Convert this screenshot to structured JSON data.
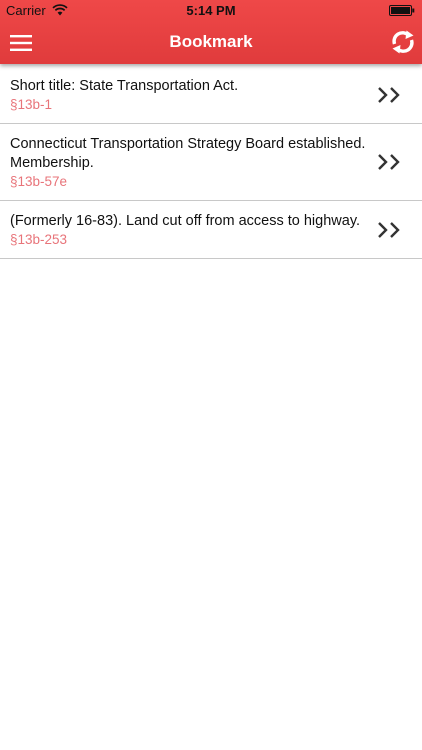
{
  "status_bar": {
    "carrier": "Carrier",
    "time": "5:14 PM"
  },
  "header": {
    "title": "Bookmark",
    "menu_icon": "hamburger-menu-icon",
    "refresh_icon": "refresh-icon",
    "background_color": "#e84444"
  },
  "bookmarks": [
    {
      "title": "Short title: State Transportation Act.",
      "section": "§13b-1"
    },
    {
      "title": "Connecticut Transportation Strategy Board established. Membership.",
      "section": "§13b-57e"
    },
    {
      "title": "(Formerly 16-83). Land cut off from access to highway.",
      "section": "§13b-253"
    }
  ],
  "colors": {
    "accent": "#e84444",
    "section_text": "#e8747a",
    "divider": "#c8c8c8"
  }
}
